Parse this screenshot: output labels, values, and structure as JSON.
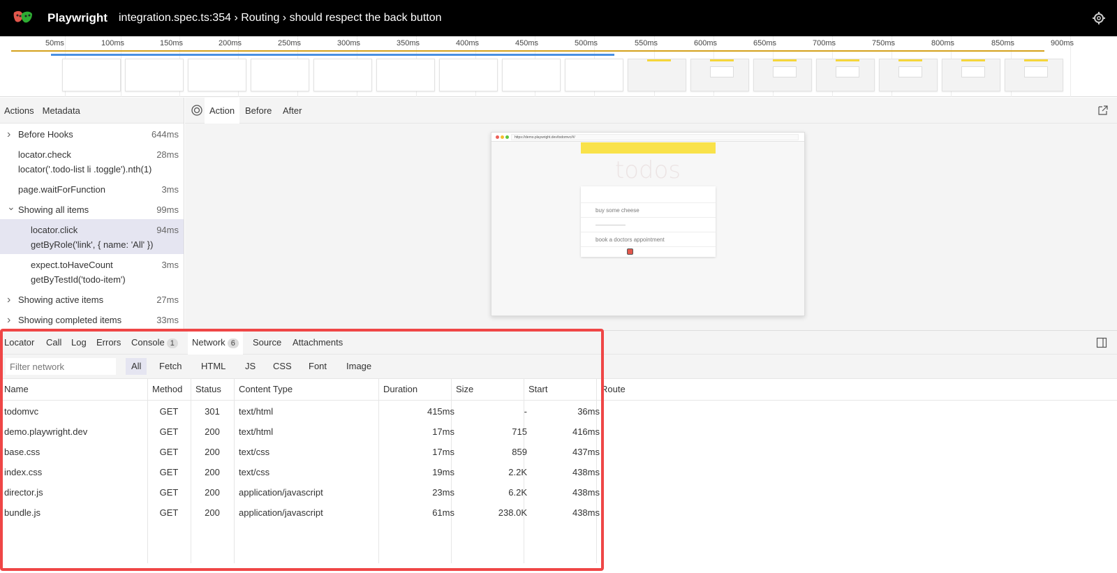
{
  "header": {
    "app_name": "Playwright",
    "title": "integration.spec.ts:354 › Routing › should respect the back button"
  },
  "timeline": {
    "ticks": [
      "50ms",
      "100ms",
      "150ms",
      "200ms",
      "250ms",
      "300ms",
      "350ms",
      "400ms",
      "450ms",
      "500ms",
      "550ms",
      "600ms",
      "650ms",
      "700ms",
      "750ms",
      "800ms",
      "850ms",
      "900ms"
    ]
  },
  "actions_panel": {
    "tabs": [
      "Actions",
      "Metadata"
    ],
    "items": [
      {
        "name": "Before Hooks",
        "time": "644ms",
        "expandable": true,
        "expanded": false
      },
      {
        "name": "locator.check",
        "sub": "locator('.todo-list li .toggle').nth(1)",
        "time": "28ms"
      },
      {
        "name": "page.waitForFunction",
        "time": "3ms"
      },
      {
        "name": "Showing all items",
        "time": "99ms",
        "expandable": true,
        "expanded": true
      },
      {
        "name": "locator.click",
        "sub": "getByRole('link', { name: 'All' })",
        "time": "94ms",
        "selected": true
      },
      {
        "name": "expect.toHaveCount",
        "sub": "getByTestId('todo-item')",
        "time": "3ms"
      },
      {
        "name": "Showing active items",
        "time": "27ms",
        "expandable": true,
        "expanded": false
      },
      {
        "name": "Showing completed items",
        "time": "33ms",
        "expandable": true,
        "expanded": false
      }
    ]
  },
  "snapshot": {
    "tabs": [
      "Action",
      "Before",
      "After"
    ],
    "active_tab": "Action",
    "url": "https://demo.playwright.dev/todomvc/#/",
    "heading": "todos",
    "todos": [
      "buy some cheese",
      "book a doctors appointment"
    ]
  },
  "bottom": {
    "tabs": [
      {
        "label": "Locator"
      },
      {
        "label": "Call"
      },
      {
        "label": "Log"
      },
      {
        "label": "Errors"
      },
      {
        "label": "Console",
        "count": "1"
      },
      {
        "label": "Network",
        "count": "6"
      },
      {
        "label": "Source"
      },
      {
        "label": "Attachments"
      }
    ],
    "active_tab": "Network",
    "filter_placeholder": "Filter network",
    "filters": [
      "All",
      "Fetch",
      "HTML",
      "JS",
      "CSS",
      "Font",
      "Image"
    ],
    "active_filter": "All",
    "columns": [
      "Name",
      "Method",
      "Status",
      "Content Type",
      "Duration",
      "Size",
      "Start",
      "Route"
    ],
    "rows": [
      {
        "name": "todomvc",
        "method": "GET",
        "status": "301",
        "content_type": "text/html",
        "duration": "415ms",
        "size": "-",
        "start": "36ms"
      },
      {
        "name": "demo.playwright.dev",
        "method": "GET",
        "status": "200",
        "content_type": "text/html",
        "duration": "17ms",
        "size": "715",
        "start": "416ms"
      },
      {
        "name": "base.css",
        "method": "GET",
        "status": "200",
        "content_type": "text/css",
        "duration": "17ms",
        "size": "859",
        "start": "437ms"
      },
      {
        "name": "index.css",
        "method": "GET",
        "status": "200",
        "content_type": "text/css",
        "duration": "19ms",
        "size": "2.2K",
        "start": "438ms"
      },
      {
        "name": "director.js",
        "method": "GET",
        "status": "200",
        "content_type": "application/javascript",
        "duration": "23ms",
        "size": "6.2K",
        "start": "438ms"
      },
      {
        "name": "bundle.js",
        "method": "GET",
        "status": "200",
        "content_type": "application/javascript",
        "duration": "61ms",
        "size": "238.0K",
        "start": "438ms"
      }
    ]
  },
  "colors": {
    "highlight": "#ef4646",
    "timeline_orange": "#d5a11c",
    "timeline_blue": "#4a90e2",
    "selected_row": "#e5e5f1"
  }
}
